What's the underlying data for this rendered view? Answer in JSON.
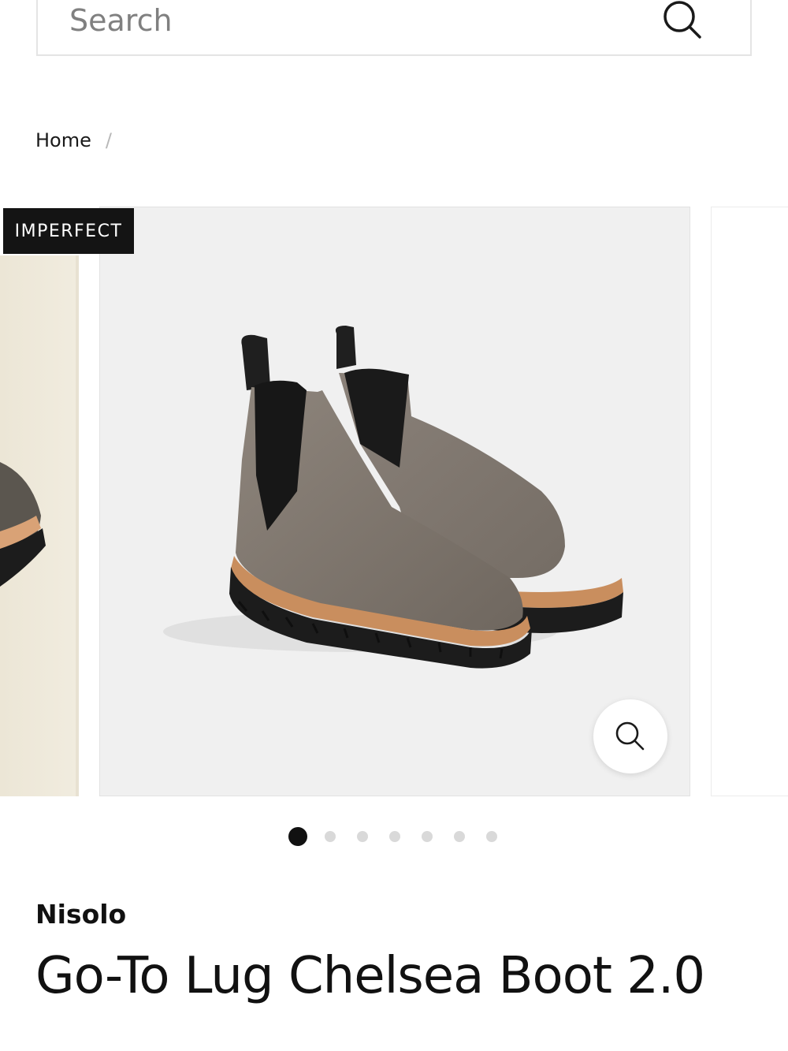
{
  "search": {
    "placeholder": "Search",
    "icon": "search-icon"
  },
  "breadcrumb": {
    "items": [
      "Home"
    ],
    "separator": "/"
  },
  "gallery": {
    "badge": "IMPERFECT",
    "zoom_icon": "zoom-icon",
    "slide_count": 7,
    "active_slide": 1
  },
  "product": {
    "brand": "Nisolo",
    "title": "Go-To Lug Chelsea Boot 2.0"
  },
  "colors": {
    "badge_bg": "#141414",
    "image_bg": "#f0f0f0",
    "dot_active": "#111111",
    "dot_inactive": "#d9d9d9"
  }
}
